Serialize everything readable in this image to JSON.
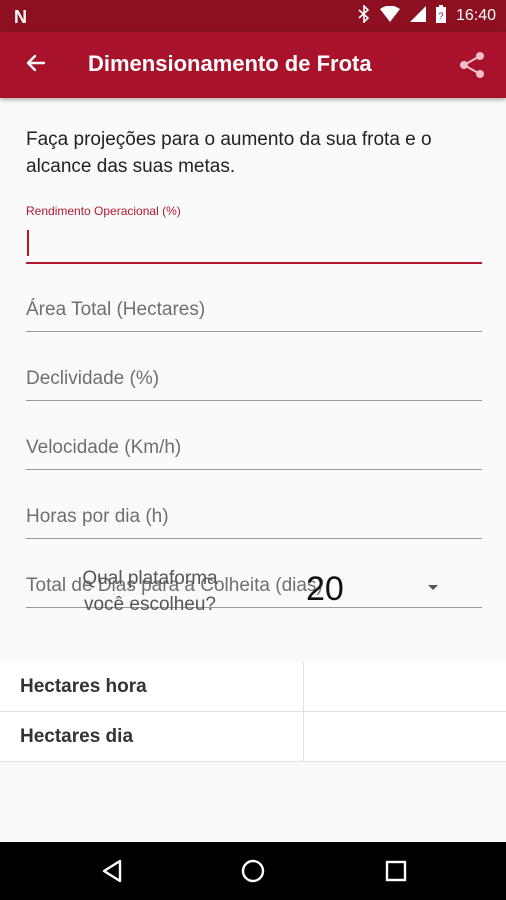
{
  "status_bar": {
    "time": "16:40",
    "notification_icon": "N"
  },
  "app_bar": {
    "title": "Dimensionamento de Frota",
    "back_icon": "arrow-left-icon",
    "share_icon": "share-icon"
  },
  "intro_text": "Faça projeções para o aumento da sua frota e o alcance das suas metas.",
  "fields": {
    "rendimento_label": "Rendimento Operacional (%)",
    "area_placeholder": "Área Total (Hectares)",
    "declividade_placeholder": "Declividade (%)",
    "velocidade_placeholder": "Velocidade (Km/h)",
    "horas_placeholder": "Horas por dia (h)",
    "dias_placeholder": "Total de Dias para a Colheita (dias)"
  },
  "platform": {
    "question_line1": "Qual plataforma",
    "question_line2": "você escolheu?",
    "selected_value": "20"
  },
  "results": [
    {
      "label": "Hectares hora",
      "value": ""
    },
    {
      "label": "Hectares dia",
      "value": ""
    }
  ],
  "colors": {
    "primary": "#a8122a",
    "primary_dark": "#8c1020",
    "accent": "#b3182f"
  }
}
